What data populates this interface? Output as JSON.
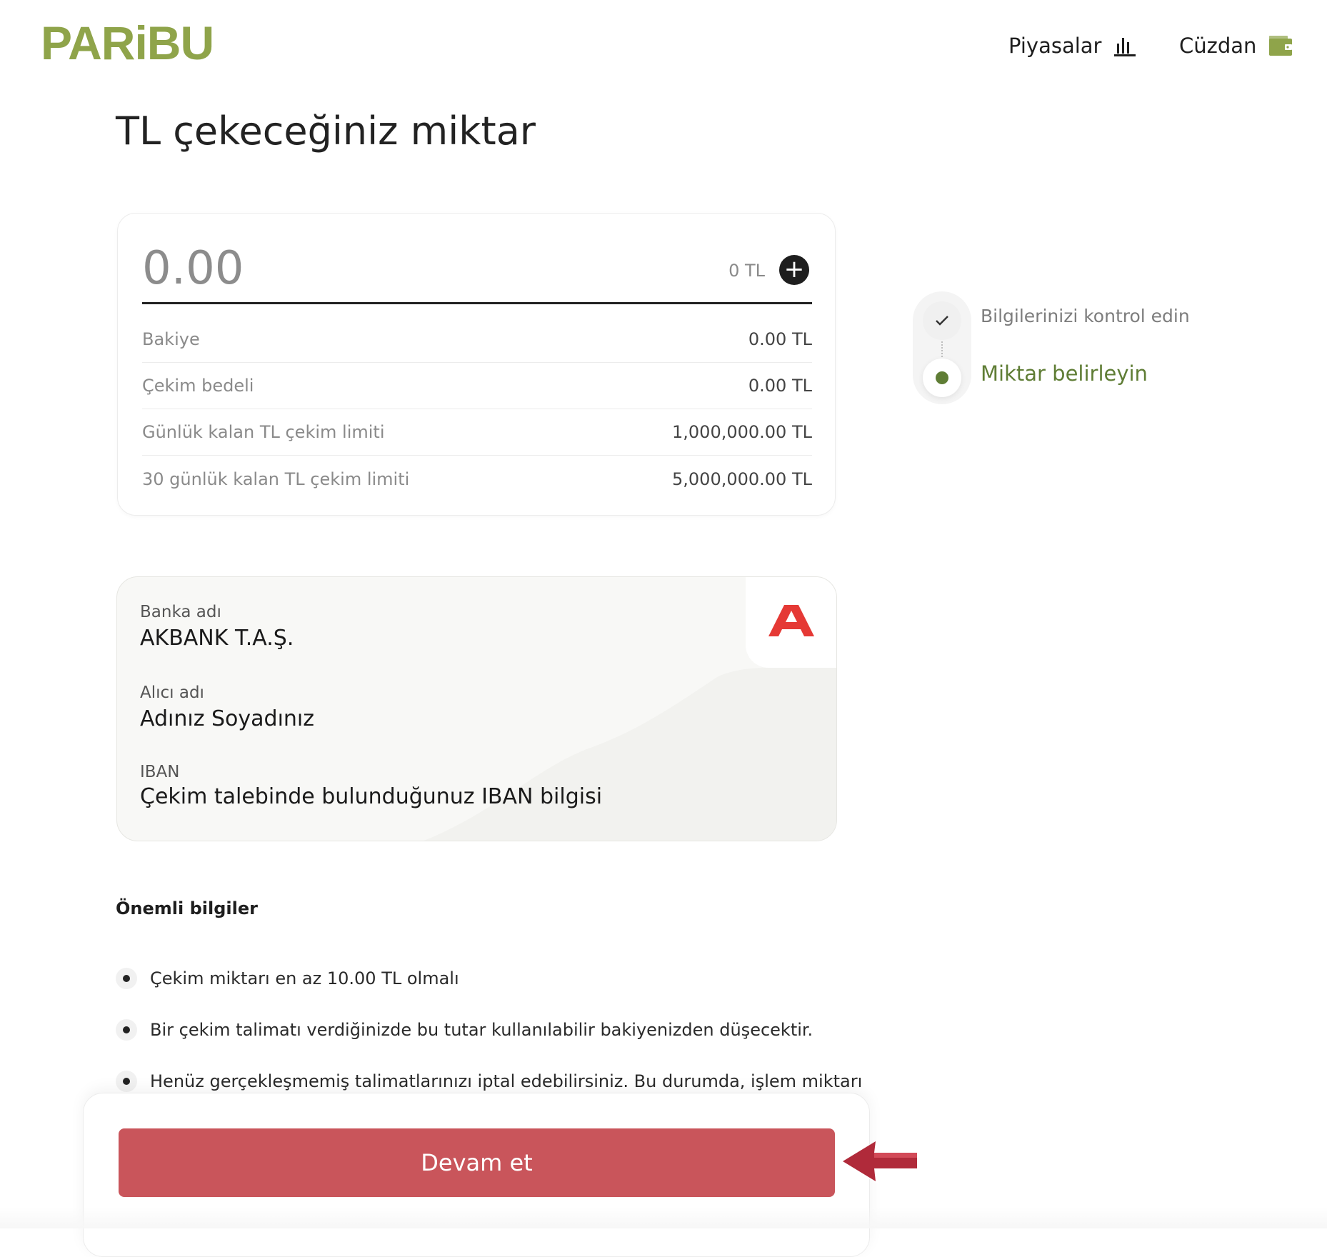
{
  "header": {
    "logo_text": "PARiBU",
    "nav": [
      {
        "label": "Piyasalar",
        "icon": "chart-bars-icon"
      },
      {
        "label": "Cüzdan",
        "icon": "wallet-icon"
      }
    ]
  },
  "page": {
    "title": "TL çekeceğiniz miktar"
  },
  "amount": {
    "placeholder": "0.00",
    "currency_readout": "0 TL",
    "rows": [
      {
        "label": "Bakiye",
        "value": "0.00 TL"
      },
      {
        "label": "Çekim bedeli",
        "value": "0.00 TL"
      },
      {
        "label": "Günlük kalan TL çekim limiti",
        "value": "1,000,000.00 TL"
      },
      {
        "label": "30 günlük kalan TL çekim limiti",
        "value": "5,000,000.00 TL"
      }
    ]
  },
  "bank": {
    "bank_name_label": "Banka adı",
    "bank_name_value": "AKBANK T.A.Ş.",
    "recipient_label": "Alıcı adı",
    "recipient_value": "Adınız Soyadınız",
    "iban_label": "IBAN",
    "iban_value": "Çekim talebinde bulunduğunuz IBAN bilgisi",
    "logo_icon": "akbank-logo-icon",
    "brand_color": "#e53935"
  },
  "stepper": {
    "steps": [
      {
        "label": "Bilgilerinizi kontrol edin",
        "state": "done"
      },
      {
        "label": "Miktar belirleyin",
        "state": "active"
      }
    ]
  },
  "important": {
    "title": "Önemli bilgiler",
    "items": [
      "Çekim miktarı en az 10.00 TL olmalı",
      "Bir çekim talimatı verdiğinizde bu tutar kullanılabilir bakiyenizden düşecektir.",
      "Henüz gerçekleşmemiş talimatlarınızı iptal edebilirsiniz. Bu durumda, işlem miktarı"
    ]
  },
  "actions": {
    "continue_label": "Devam et"
  },
  "colors": {
    "brand_green": "#8fa44a",
    "active_step_green": "#5f7d35",
    "button_red": "#c9555b",
    "annotation_arrow": "#b02a3a"
  }
}
